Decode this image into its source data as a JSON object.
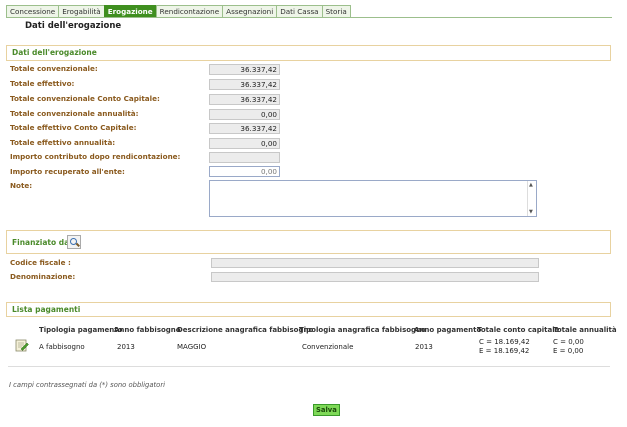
{
  "tabs": [
    {
      "label": "Concessione",
      "active": false
    },
    {
      "label": "Erogabilità",
      "active": false
    },
    {
      "label": "Erogazione",
      "active": true
    },
    {
      "label": "Rendicontazione",
      "active": false
    },
    {
      "label": "Assegnazioni",
      "active": false
    },
    {
      "label": "Dati Cassa",
      "active": false
    },
    {
      "label": "Storia",
      "active": false
    }
  ],
  "page_title": "Dati dell'erogazione",
  "section_dati": {
    "title": "Dati dell'erogazione",
    "fields": {
      "totale_convenzionale": {
        "label": "Totale convenzionale:",
        "value": "36.337,42"
      },
      "totale_effettivo": {
        "label": "Totale effettivo:",
        "value": "36.337,42"
      },
      "totale_conv_conto_capitale": {
        "label": "Totale convenzionale Conto Capitale:",
        "value": "36.337,42"
      },
      "totale_conv_annualita": {
        "label": "Totale convenzionale annualità:",
        "value": "0,00"
      },
      "totale_eff_conto_capitale": {
        "label": "Totale effettivo Conto Capitale:",
        "value": "36.337,42"
      },
      "totale_eff_annualita": {
        "label": "Totale effettivo annualità:",
        "value": "0,00"
      },
      "importo_contributo": {
        "label": "Importo contributo dopo rendicontazione:",
        "value": ""
      },
      "importo_recuperato": {
        "label": "Importo recuperato all'ente:",
        "value": "0,00"
      },
      "note": {
        "label": "Note:",
        "value": ""
      }
    }
  },
  "section_finanziato": {
    "title": "Finanziato da",
    "codice_fiscale_label": "Codice fiscale :",
    "denominazione_label": "Denominazione:"
  },
  "section_pagamenti": {
    "title": "Lista pagamenti",
    "columns": [
      "Tipologia pagamento",
      "Anno fabbisogno",
      "Descrizione anagrafica fabbisogno",
      "Tipologia anagrafica fabbisogno",
      "Anno pagamento",
      "Totale conto capitale",
      "Totale annualità"
    ],
    "row": {
      "tipologia": "A fabbisogno",
      "anno_fabbisogno": "2013",
      "descrizione": "MAGGIO",
      "tipologia_anagrafica": "Convenzionale",
      "anno_pagamento": "2013",
      "conto_capitale_c": "C = 18.169,42",
      "conto_capitale_e": "E = 18.169,42",
      "annualita_c": "C = 0,00",
      "annualita_e": "E = 0,00"
    }
  },
  "footer_note": "I campi contrassegnati da (*) sono obbligatori",
  "save_label": "Salva",
  "colors": {
    "accent": "#3f8f1f",
    "label": "#8a5a1e",
    "section_border": "#e8d2a0"
  }
}
